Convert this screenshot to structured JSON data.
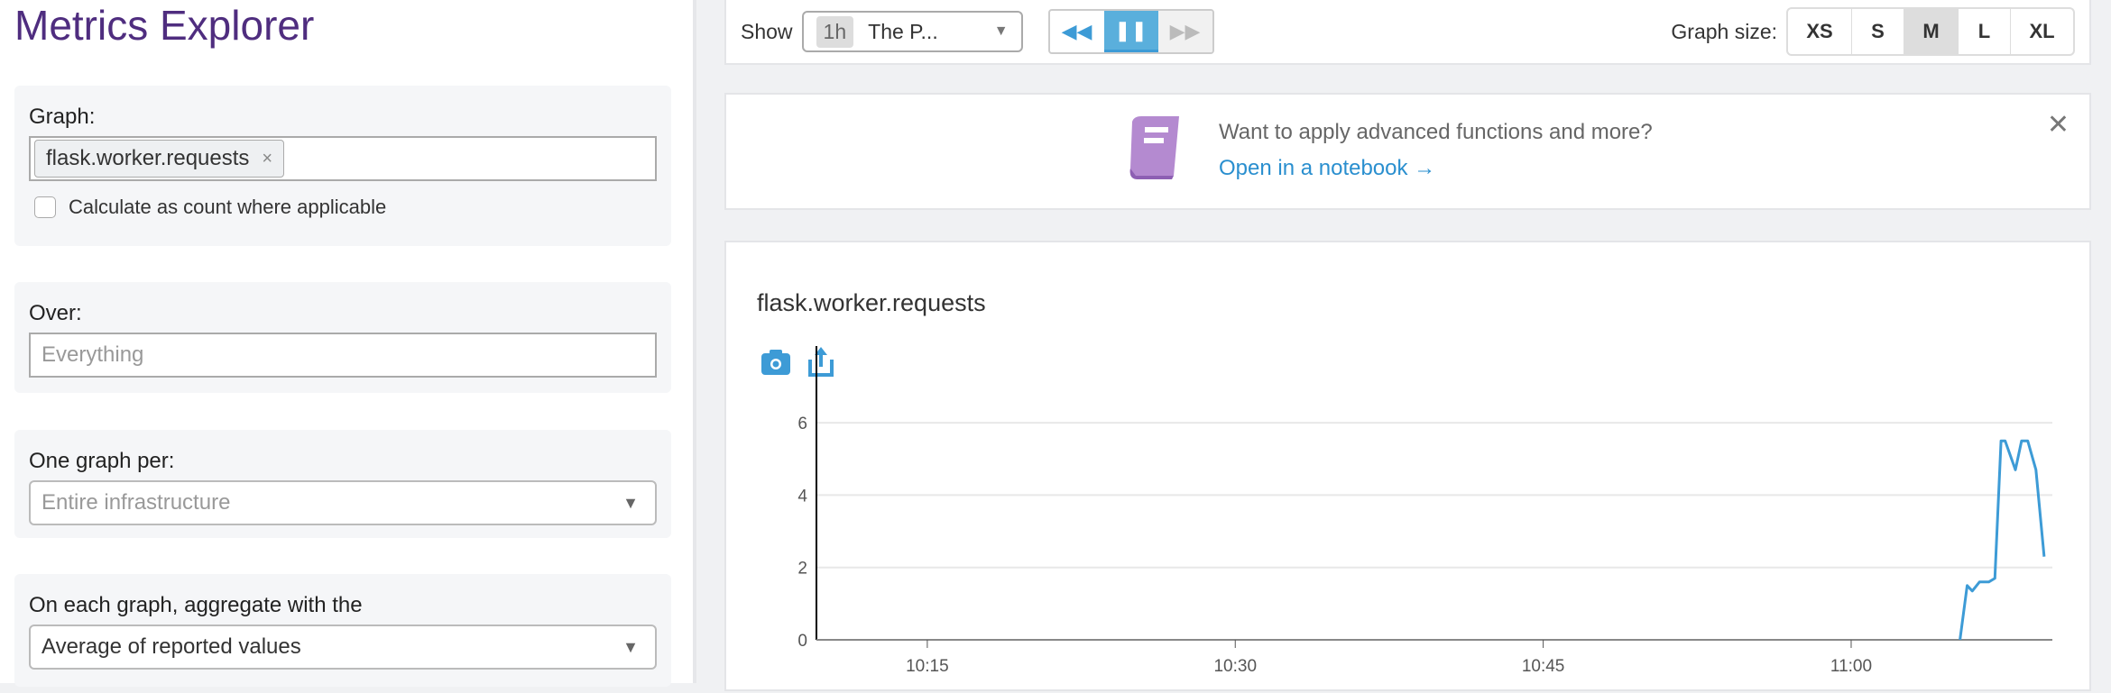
{
  "sidebar": {
    "title": "Metrics Explorer",
    "graph": {
      "label": "Graph:",
      "tag": "flask.worker.requests",
      "tag_remove": "×",
      "checkbox_label": "Calculate as count where applicable",
      "checked": false
    },
    "over": {
      "label": "Over:",
      "placeholder": "Everything"
    },
    "one_graph_per": {
      "label": "One graph per:",
      "value": "Entire infrastructure"
    },
    "aggregate": {
      "label": "On each graph, aggregate with the",
      "value": "Average of reported values"
    }
  },
  "toolbar": {
    "show_label": "Show",
    "range_pill": "1h",
    "range_text": "The P...",
    "graph_size_label": "Graph size:",
    "sizes": [
      "XS",
      "S",
      "M",
      "L",
      "XL"
    ],
    "active_size": "M",
    "accent": "#3d9bd6"
  },
  "banner": {
    "text": "Want to apply advanced functions and more?",
    "link": "Open in a notebook →"
  },
  "chart_data": {
    "type": "line",
    "title": "flask.worker.requests",
    "xlabel": "",
    "ylabel": "",
    "x_unit": "minutes after 10:00",
    "xlim": [
      9.6,
      69.8
    ],
    "ylim": [
      0,
      7
    ],
    "yticks": [
      0,
      2,
      4,
      6
    ],
    "xticks": [
      {
        "v": 15,
        "label": "10:15"
      },
      {
        "v": 30,
        "label": "10:30"
      },
      {
        "v": 45,
        "label": "10:45"
      },
      {
        "v": 60,
        "label": "11:00"
      }
    ],
    "grid": true,
    "color": "#3d9bd6",
    "series": [
      {
        "name": "flask.worker.requests",
        "x": [
          65.3,
          65.65,
          65.9,
          66.25,
          66.7,
          67.0,
          67.3,
          67.5,
          68.0,
          68.3,
          68.6,
          69.0,
          69.4
        ],
        "y": [
          0,
          1.5,
          1.35,
          1.6,
          1.6,
          1.7,
          5.5,
          5.5,
          4.7,
          5.5,
          5.5,
          4.7,
          2.3
        ]
      }
    ]
  }
}
